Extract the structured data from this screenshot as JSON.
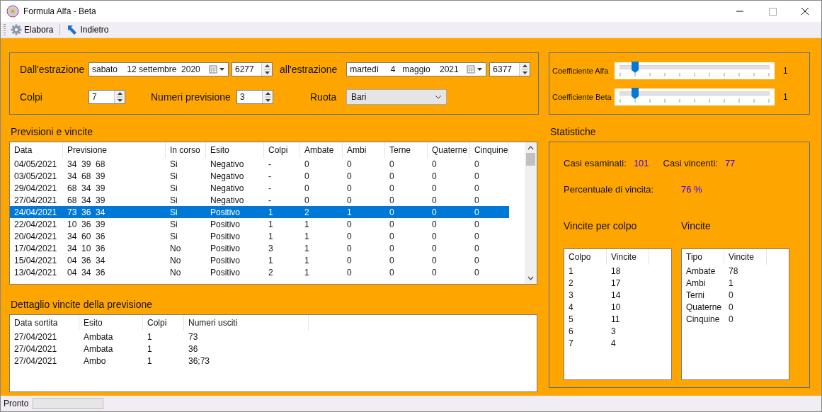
{
  "window": {
    "title": "Formula Alfa - Beta"
  },
  "toolbar": [
    {
      "kind": "gear",
      "label": "Elabora"
    },
    {
      "kind": "back",
      "label": "Indietro"
    }
  ],
  "filters": {
    "from_label": "Dall'estrazione",
    "from_date": "sabato    12 settembre  2020",
    "from_number": "6277",
    "to_label": "all'estrazione",
    "to_date": "martedì     4   maggio    2021",
    "to_number": "6377",
    "colpi_label": "Colpi",
    "colpi": "7",
    "numeri_label": "Numeri previsione",
    "numeri": "3",
    "ruota_label": "Ruota",
    "ruota": "Bari"
  },
  "coefficients": [
    {
      "label": "Coefficiente Alfa",
      "level": 0.1,
      "value": "1"
    },
    {
      "label": "Coefficiente Beta",
      "level": 0.1,
      "value": "1"
    }
  ],
  "predictions": {
    "title": "Previsioni e vincite",
    "columns": [
      "Data",
      "Previsione",
      "In corso",
      "Esito",
      "Colpi",
      "Ambate",
      "Ambi",
      "Terne",
      "Quaterne",
      "Cinquine"
    ],
    "rows": [
      {
        "selected": false,
        "cells": [
          "04/05/2021",
          "34  39  68",
          "Si",
          "Negativo",
          "-",
          "0",
          "0",
          "0",
          "0",
          "0"
        ]
      },
      {
        "selected": false,
        "cells": [
          "03/05/2021",
          "34  68  39",
          "Si",
          "Negativo",
          "-",
          "0",
          "0",
          "0",
          "0",
          "0"
        ]
      },
      {
        "selected": false,
        "cells": [
          "29/04/2021",
          "68  34  39",
          "Si",
          "Negativo",
          "-",
          "0",
          "0",
          "0",
          "0",
          "0"
        ]
      },
      {
        "selected": false,
        "cells": [
          "27/04/2021",
          "68  34  39",
          "Si",
          "Negativo",
          "-",
          "0",
          "0",
          "0",
          "0",
          "0"
        ]
      },
      {
        "selected": true,
        "cells": [
          "24/04/2021",
          "73  36  34",
          "Si",
          "Positivo",
          "1",
          "2",
          "1",
          "0",
          "0",
          "0"
        ]
      },
      {
        "selected": false,
        "cells": [
          "22/04/2021",
          "10  36  39",
          "Si",
          "Positivo",
          "1",
          "1",
          "0",
          "0",
          "0",
          "0"
        ]
      },
      {
        "selected": false,
        "cells": [
          "20/04/2021",
          "34  60  36",
          "Si",
          "Positivo",
          "1",
          "1",
          "0",
          "0",
          "0",
          "0"
        ]
      },
      {
        "selected": false,
        "cells": [
          "17/04/2021",
          "34  10  36",
          "No",
          "Positivo",
          "3",
          "1",
          "0",
          "0",
          "0",
          "0"
        ]
      },
      {
        "selected": false,
        "cells": [
          "15/04/2021",
          "04  36  34",
          "No",
          "Positivo",
          "1",
          "1",
          "0",
          "0",
          "0",
          "0"
        ]
      },
      {
        "selected": false,
        "cells": [
          "13/04/2021",
          "04  34  36",
          "No",
          "Positivo",
          "2",
          "1",
          "0",
          "0",
          "0",
          "0"
        ]
      }
    ]
  },
  "detail": {
    "title": "Dettaglio vincite della previsione",
    "columns": [
      "Data sortita",
      "Esito",
      "Colpi",
      "Numeri usciti"
    ],
    "rows": [
      {
        "cells": [
          "27/04/2021",
          "Ambata",
          "1",
          "73"
        ]
      },
      {
        "cells": [
          "27/04/2021",
          "Ambata",
          "1",
          "36"
        ]
      },
      {
        "cells": [
          "27/04/2021",
          "Ambo",
          "1",
          "36;73"
        ]
      }
    ]
  },
  "statistics": {
    "title": "Statistiche",
    "casi_esaminati_label": "Casi esaminati:",
    "casi_esaminati": "101",
    "casi_vincenti_label": "Casi vincenti:",
    "casi_vincenti": "77",
    "percentuale_label": "Percentuale di vincita:",
    "percentuale": "76 %",
    "per_colpo": {
      "title": "Vincite per colpo",
      "columns": [
        "Colpo",
        "Vincite"
      ],
      "rows": [
        {
          "cells": [
            "1",
            "18"
          ]
        },
        {
          "cells": [
            "2",
            "17"
          ]
        },
        {
          "cells": [
            "3",
            "14"
          ]
        },
        {
          "cells": [
            "4",
            "10"
          ]
        },
        {
          "cells": [
            "5",
            "11"
          ]
        },
        {
          "cells": [
            "6",
            "3"
          ]
        },
        {
          "cells": [
            "7",
            "4"
          ]
        }
      ]
    },
    "per_tipo": {
      "title": "Vincite",
      "columns": [
        "Tipo",
        "Vincite"
      ],
      "rows": [
        {
          "cells": [
            "Ambate",
            "78"
          ]
        },
        {
          "cells": [
            "Ambi",
            "1"
          ]
        },
        {
          "cells": [
            "Terni",
            "0"
          ]
        },
        {
          "cells": [
            "Quaterne",
            "0"
          ]
        },
        {
          "cells": [
            "Cinquine",
            "0"
          ]
        }
      ]
    }
  },
  "status_bar": {
    "text": "Pronto",
    "progress": {
      "level": 0
    }
  }
}
